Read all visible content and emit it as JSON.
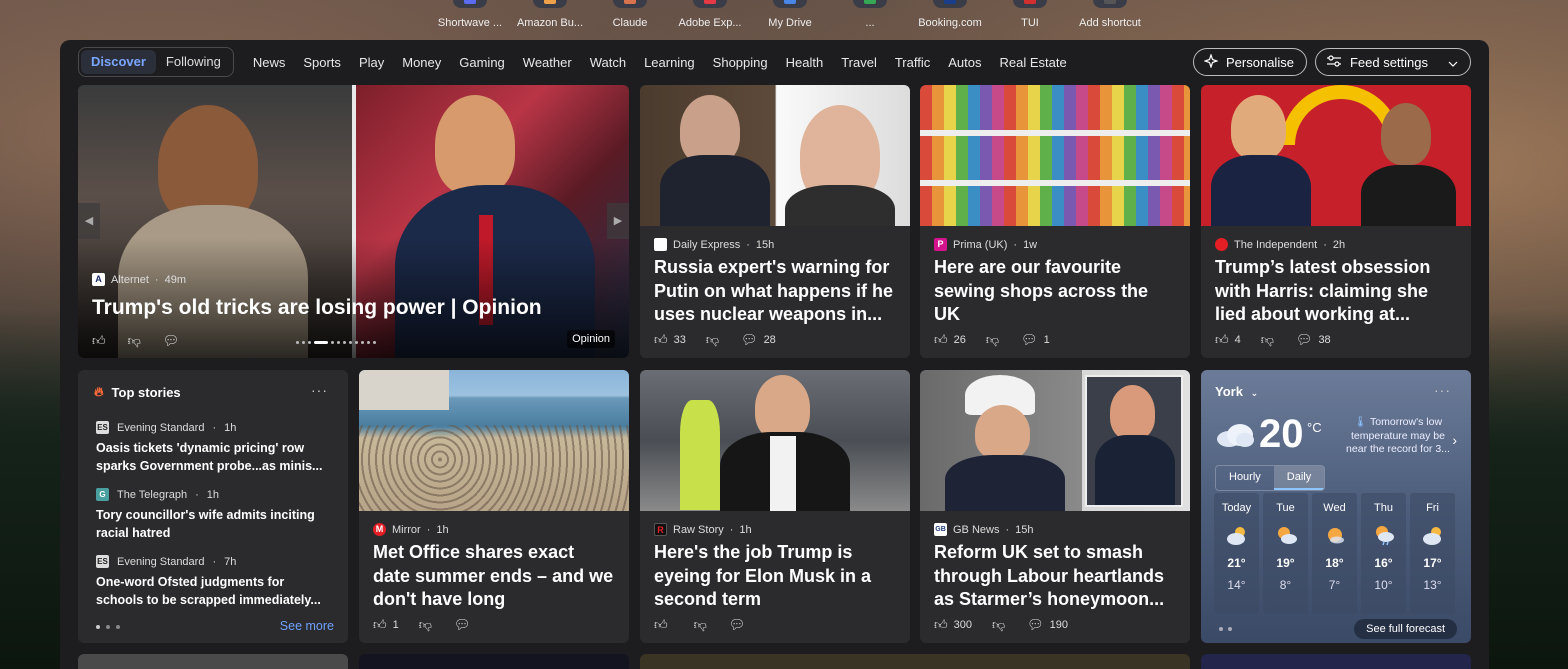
{
  "shortcuts": [
    {
      "label": "Shortwave ...",
      "color": "#5b6cf0"
    },
    {
      "label": "Amazon Bu...",
      "color": "#f0a04b"
    },
    {
      "label": "Claude",
      "color": "#d9734e"
    },
    {
      "label": "Adobe Exp...",
      "color": "#e63946"
    },
    {
      "label": "My Drive",
      "color": "#4a86e8"
    },
    {
      "label": "...",
      "color": "#34a853"
    },
    {
      "label": "Booking.com",
      "color": "#1a3e8c"
    },
    {
      "label": "TUI",
      "color": "#d32f2f"
    },
    {
      "label": "Add shortcut",
      "color": "#555555"
    }
  ],
  "nav": {
    "discover": "Discover",
    "following": "Following",
    "items": [
      "News",
      "Sports",
      "Play",
      "Money",
      "Gaming",
      "Weather",
      "Watch",
      "Learning",
      "Shopping",
      "Health",
      "Travel",
      "Traffic",
      "Autos",
      "Real Estate"
    ],
    "personalise": "Personalise",
    "feed_settings": "Feed settings"
  },
  "hero": {
    "source": "Alternet",
    "age": "49m",
    "title": "Trump's old tricks are losing power | Opinion",
    "tag": "Opinion"
  },
  "cards": [
    {
      "source": "Daily Express",
      "age": "15h",
      "title": "Russia expert's warning for Putin on what happens if he uses nuclear weapons in...",
      "likes": "33",
      "comments": "28",
      "logo_color": "#ffffff"
    },
    {
      "source": "Prima (UK)",
      "age": "1w",
      "title": "Here are our favourite sewing shops across the UK",
      "likes": "26",
      "comments": "1",
      "logo_color": "#d4148c"
    },
    {
      "source": "The Independent",
      "age": "2h",
      "title": "Trump’s latest obsession with Harris: claiming she lied about working at...",
      "likes": "4",
      "comments": "38",
      "logo_color": "#e31e24"
    },
    {
      "source": "Mirror",
      "age": "1h",
      "title": "Met Office shares exact date summer ends – and we don't have long",
      "likes": "1",
      "comments": "",
      "logo_color": "#e31e24"
    },
    {
      "source": "Raw Story",
      "age": "1h",
      "title": "Here's the job Trump is eyeing for Elon Musk in a second term",
      "likes": "",
      "comments": "",
      "logo_color": "#111111"
    },
    {
      "source": "GB News",
      "age": "15h",
      "title": "Reform UK set to smash through Labour heartlands as Starmer’s honeymoon...",
      "likes": "300",
      "comments": "190",
      "logo_color": "#1f3b82"
    }
  ],
  "stories": {
    "heading": "Top stories",
    "items": [
      {
        "source": "Evening Standard",
        "age": "1h",
        "title": "Oasis tickets 'dynamic pricing' row sparks Government probe...as minis..."
      },
      {
        "source": "The Telegraph",
        "age": "1h",
        "title": "Tory councillor's wife admits inciting racial hatred"
      },
      {
        "source": "Evening Standard",
        "age": "7h",
        "title": "One-word Ofsted judgments for schools to be scrapped immediately..."
      }
    ],
    "see_more": "See more"
  },
  "weather": {
    "location": "York",
    "temp": "20",
    "unit": "°C",
    "note": "Tomorrow's low temperature may be near the record for 3...",
    "tab_hourly": "Hourly",
    "tab_daily": "Daily",
    "days": [
      {
        "name": "Today",
        "hi": "21°",
        "lo": "14°",
        "icon": "cloudy-sun-icon"
      },
      {
        "name": "Tue",
        "hi": "19°",
        "lo": "8°",
        "icon": "sun-cloud-icon"
      },
      {
        "name": "Wed",
        "hi": "18°",
        "lo": "7°",
        "icon": "sunny-icon"
      },
      {
        "name": "Thu",
        "hi": "16°",
        "lo": "10°",
        "icon": "sun-rain-icon"
      },
      {
        "name": "Fri",
        "hi": "17°",
        "lo": "13°",
        "icon": "cloudy-sun-icon"
      }
    ],
    "see_forecast": "See full forecast"
  }
}
